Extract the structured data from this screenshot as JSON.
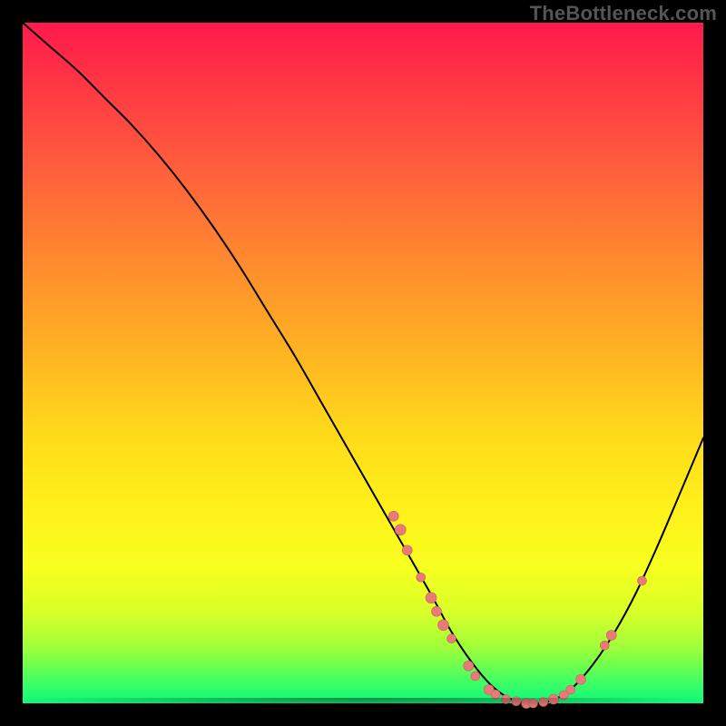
{
  "watermark": "TheBottleneck.com",
  "colors": {
    "background": "#000000",
    "curve_stroke": "#000000",
    "marker_fill": "#e87a7a",
    "marker_stroke": "#c95f5f"
  },
  "chart_data": {
    "type": "line",
    "title": "",
    "xlabel": "",
    "ylabel": "",
    "xlim": [
      0,
      100
    ],
    "ylim": [
      0,
      100
    ],
    "grid": false,
    "legend": false,
    "series": [
      {
        "name": "bottleneck-curve",
        "x": [
          0,
          4,
          8,
          12,
          16,
          20,
          24,
          28,
          32,
          36,
          40,
          44,
          48,
          52,
          56,
          60,
          63,
          66,
          69,
          72,
          75,
          78,
          81,
          84,
          87,
          90,
          93,
          96,
          100
        ],
        "y": [
          100,
          96.5,
          93,
          89,
          85,
          80.5,
          75.5,
          70,
          64,
          57.5,
          51,
          44,
          37,
          30,
          23,
          16,
          10.5,
          6,
          2.5,
          0.5,
          0,
          0.5,
          2.5,
          6,
          10.5,
          16,
          22.5,
          29.5,
          39
        ]
      }
    ],
    "markers": [
      {
        "x": 54.5,
        "y": 27.5,
        "r": 5.5
      },
      {
        "x": 55.5,
        "y": 25.5,
        "r": 6.0
      },
      {
        "x": 56.5,
        "y": 22.5,
        "r": 5.5
      },
      {
        "x": 58.5,
        "y": 18.5,
        "r": 5.0
      },
      {
        "x": 60.0,
        "y": 15.5,
        "r": 6.0
      },
      {
        "x": 60.8,
        "y": 13.5,
        "r": 5.5
      },
      {
        "x": 61.8,
        "y": 11.5,
        "r": 6.0
      },
      {
        "x": 63.0,
        "y": 9.5,
        "r": 5.0
      },
      {
        "x": 65.5,
        "y": 5.5,
        "r": 5.5
      },
      {
        "x": 66.5,
        "y": 4.0,
        "r": 5.0
      },
      {
        "x": 68.5,
        "y": 2.0,
        "r": 5.5
      },
      {
        "x": 69.5,
        "y": 1.3,
        "r": 5.0
      },
      {
        "x": 71.0,
        "y": 0.6,
        "r": 5.0
      },
      {
        "x": 72.5,
        "y": 0.3,
        "r": 5.0
      },
      {
        "x": 74.0,
        "y": 0.0,
        "r": 5.5
      },
      {
        "x": 75.0,
        "y": 0.0,
        "r": 5.0
      },
      {
        "x": 76.5,
        "y": 0.2,
        "r": 5.0
      },
      {
        "x": 78.0,
        "y": 0.6,
        "r": 5.5
      },
      {
        "x": 79.5,
        "y": 1.2,
        "r": 5.0
      },
      {
        "x": 80.5,
        "y": 2.0,
        "r": 5.0
      },
      {
        "x": 82.0,
        "y": 3.5,
        "r": 5.5
      },
      {
        "x": 85.5,
        "y": 8.5,
        "r": 5.0
      },
      {
        "x": 86.5,
        "y": 10.0,
        "r": 5.5
      },
      {
        "x": 91.0,
        "y": 18.0,
        "r": 5.0
      }
    ]
  }
}
